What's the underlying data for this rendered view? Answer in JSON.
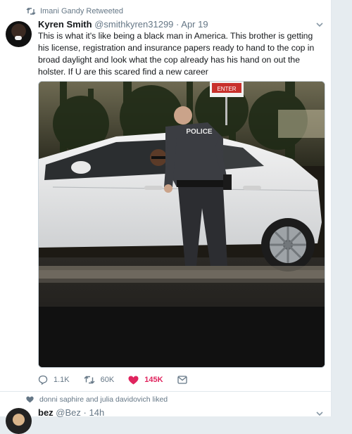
{
  "tweet": {
    "retweet_context": "Imani Gandy Retweeted",
    "author_name": "Kyren Smith",
    "author_handle": "@smithkyren31299",
    "date": "Apr 19",
    "text": "This is what it's like being a black man in America. This brother is getting his license, registration and insurance papers ready to hand to the cop in broad daylight and look what the cop already has his hand on out the holster. If U are this scared find a new career",
    "media": {
      "police_label": "POLICE",
      "sign_label": "ENTER"
    },
    "actions": {
      "replies": "1.1K",
      "retweets": "60K",
      "likes": "145K"
    }
  },
  "next_tweet": {
    "like_context": "donni saphire and julia davidovich liked",
    "author_name": "bez",
    "author_handle": "@Bez",
    "date": "14h"
  },
  "colors": {
    "text": "#14171a",
    "secondary": "#657786",
    "like_pink": "#e0245e",
    "background": "#e6ecf0",
    "border": "#e1e8ed"
  },
  "icons": [
    "retweet-icon",
    "chevron-down-icon",
    "reply-icon",
    "heart-icon",
    "message-icon"
  ]
}
